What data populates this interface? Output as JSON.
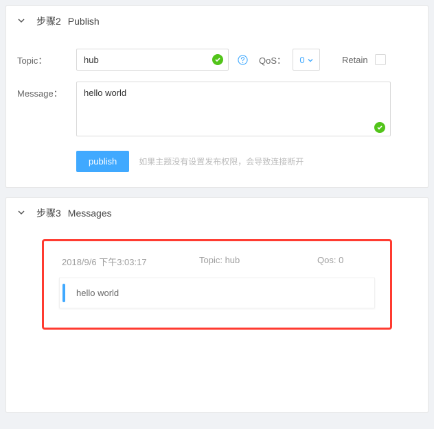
{
  "step2": {
    "step_label": "步骤2",
    "title": "Publish",
    "topic_label": "Topic：",
    "topic_value": "hub",
    "qos_label": "QoS：",
    "qos_value": "0",
    "retain_label": "Retain",
    "message_label": "Message：",
    "message_value": "hello world",
    "publish_button": "publish",
    "publish_hint": "如果主题没有设置发布权限，会导致连接断开"
  },
  "step3": {
    "step_label": "步骤3",
    "title": "Messages",
    "message": {
      "timestamp": "2018/9/6 下午3:03:17",
      "topic_label": "Topic: hub",
      "qos_label": "Qos: 0",
      "body": "hello world"
    }
  }
}
